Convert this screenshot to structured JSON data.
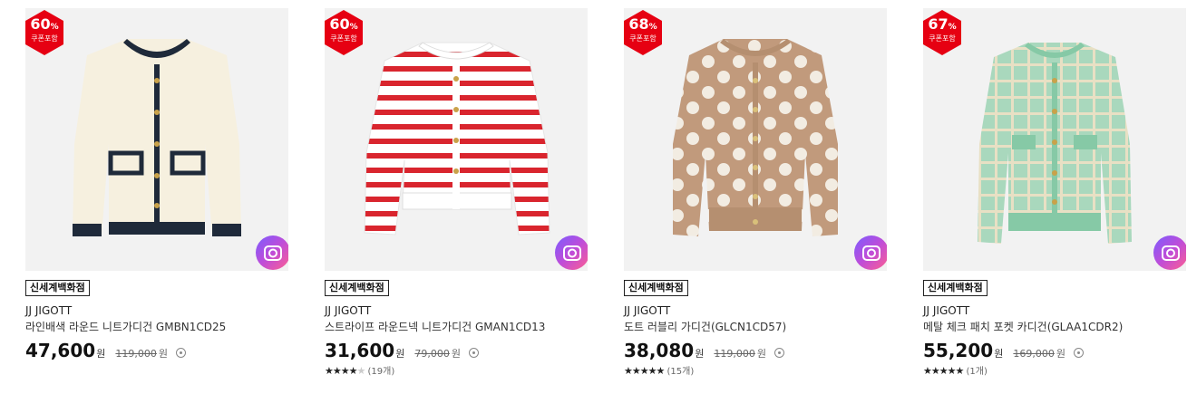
{
  "products": [
    {
      "discount": "60",
      "discount_unit": "%",
      "coupon": "쿠폰포함",
      "store": "신세계백화점",
      "brand": "JJ JIGOTT",
      "name": "라인배색 라운드 니트가디건 GMBN1CD25",
      "price": "47,600",
      "won": "원",
      "orig": "119,000",
      "orig_won": "원",
      "stars_filled": "",
      "stars_empty": "",
      "review": ""
    },
    {
      "discount": "60",
      "discount_unit": "%",
      "coupon": "쿠폰포함",
      "store": "신세계백화점",
      "brand": "JJ JIGOTT",
      "name": "스트라이프 라운드넥 니트가디건 GMAN1CD13",
      "price": "31,600",
      "won": "원",
      "orig": "79,000",
      "orig_won": "원",
      "stars_filled": "★★★★",
      "stars_empty": "★",
      "review": "(19개)"
    },
    {
      "discount": "68",
      "discount_unit": "%",
      "coupon": "쿠폰포함",
      "store": "신세계백화점",
      "brand": "JJ JIGOTT",
      "name": "도트 러블리 가디건(GLCN1CD57)",
      "price": "38,080",
      "won": "원",
      "orig": "119,000",
      "orig_won": "원",
      "stars_filled": "★★★★★",
      "stars_empty": "",
      "review": "(15개)"
    },
    {
      "discount": "67",
      "discount_unit": "%",
      "coupon": "쿠폰포함",
      "store": "신세계백화점",
      "brand": "JJ JIGOTT",
      "name": "메탈 체크 패치 포켓 카디건(GLAA1CDR2)",
      "price": "55,200",
      "won": "원",
      "orig": "169,000",
      "orig_won": "원",
      "stars_filled": "★★★★★",
      "stars_empty": "",
      "review": "(1개)"
    }
  ],
  "colors": {
    "badge": "#e60012",
    "thumb_bg": "#f2f2f2"
  }
}
